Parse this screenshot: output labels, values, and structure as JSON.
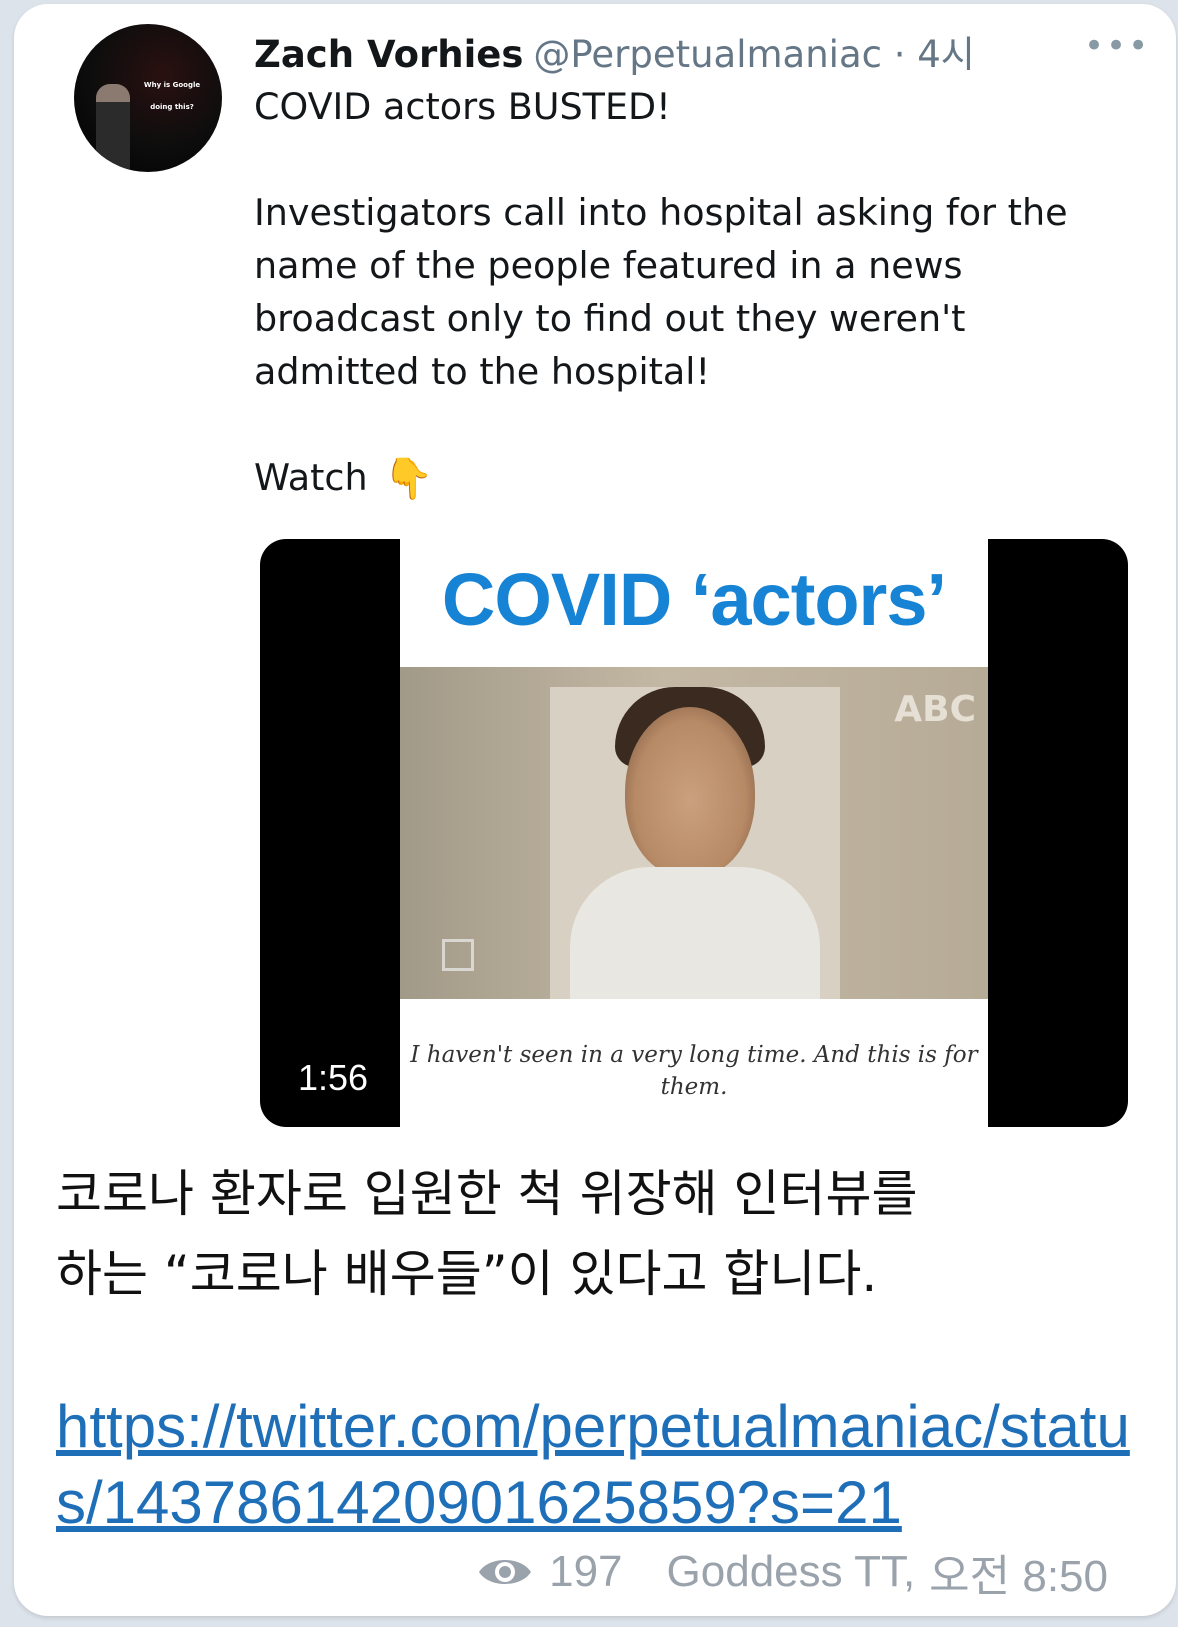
{
  "tweet": {
    "author_name": "Zach Vorhies",
    "author_handle": "@Perpetualmaniac · 4시",
    "avatar_screen_text": "Why is Google doing this?",
    "more_icon": "more-horizontal-icon",
    "paragraphs": [
      "COVID actors BUSTED!",
      "Investigators call into hospital asking for the name of the people featured in a news broadcast only to find out they weren't admitted to the hospital!"
    ],
    "watch_label": "Watch",
    "watch_emoji": "👇"
  },
  "video": {
    "title": "COVID ‘actors’",
    "logo_text": "ABC",
    "caption": "I haven't seen in a very long time. And this is for them.",
    "duration": "1:56"
  },
  "message": {
    "text": "코로나 환자로 입원한 척 위장해 인터뷰를\n하는 “코로나 배우들”이 있다고 합니다.",
    "link": "https://twitter.com/perpetualmaniac/status/1437861420901625859?s=21",
    "views": "197",
    "author": "Goddess TT,",
    "time": "오전 8:50"
  },
  "colors": {
    "background": "#dde3ea",
    "bubble": "#ffffff",
    "link": "#1f6fb8",
    "meta": "#9aa3ab",
    "video_title": "#1783d4"
  }
}
